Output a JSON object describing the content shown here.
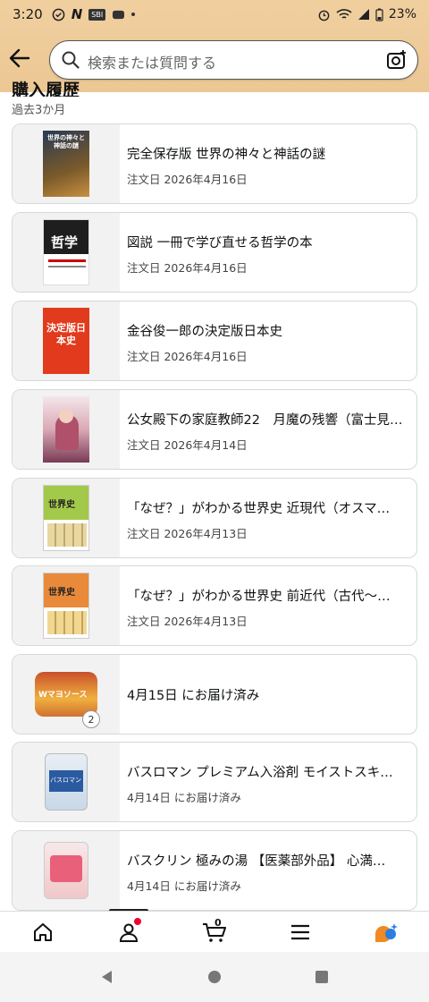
{
  "status_bar": {
    "time": "3:20",
    "battery": "23%"
  },
  "search": {
    "placeholder": "検索または質問する"
  },
  "section": {
    "title": "購入履歴",
    "subtitle": "過去3か月"
  },
  "items": [
    {
      "title": "完全保存版 世界の神々と神話の謎",
      "date": "注文日 2026年4月16日",
      "cover_text": "世界の神々と神話の謎"
    },
    {
      "title": "図説 一冊で学び直せる哲学の本",
      "date": "注文日 2026年4月16日",
      "cover_text": "哲学"
    },
    {
      "title": "金谷俊一郎の決定版日本史",
      "date": "注文日 2026年4月16日",
      "cover_text": "決定版日本史"
    },
    {
      "title": "公女殿下の家庭教師22　月魔の残響（富士見…",
      "date": "注文日 2026年4月14日",
      "cover_text": ""
    },
    {
      "title": "「なぜ？」がわかる世界史 近現代（オスマ…",
      "date": "注文日 2026年4月13日",
      "cover_text": "世界史"
    },
    {
      "title": "「なぜ？」がわかる世界史 前近代（古代〜…",
      "date": "注文日 2026年4月13日",
      "cover_text": "世界史"
    },
    {
      "title": "4月15日 にお届け済み",
      "date": "",
      "qty": "2",
      "cover_text": "Wマヨソース"
    },
    {
      "title": "バスロマン プレミアム入浴剤 モイストスキ…",
      "date": "4月14日 にお届け済み",
      "cover_text": "バスロマン"
    },
    {
      "title": "バスクリン 極みの湯 【医薬部外品】 心満…",
      "date": "4月14日 にお届け済み",
      "cover_text": ""
    }
  ],
  "bottom_nav": {
    "cart_count": "0"
  },
  "colors": {
    "header_bg": "#ecc794",
    "card_border": "#d5d9d9",
    "badge": "#e03"
  }
}
